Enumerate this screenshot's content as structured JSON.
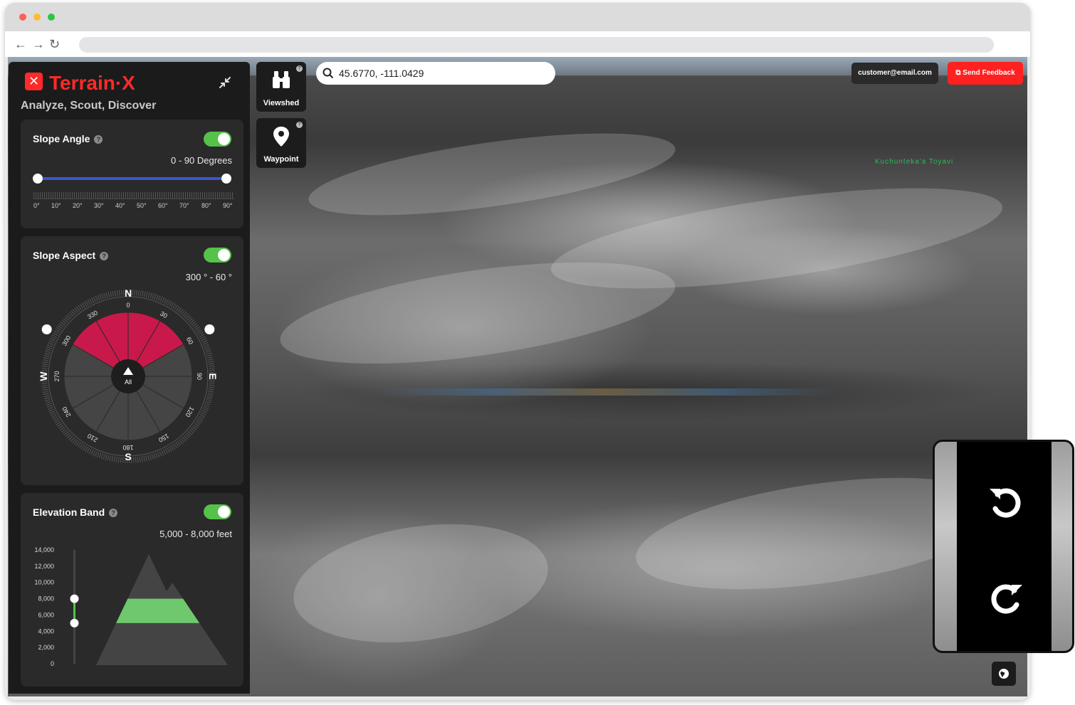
{
  "colors": {
    "brand": "#ff2a2a",
    "toggle_on": "#55c24a",
    "slider": "#3b55d6",
    "aspect_fill": "#c8194a",
    "band_fill": "#6fc86d",
    "panel": "#1b1b1b",
    "card": "#2a2a2a"
  },
  "app": {
    "logo_mark": "✕",
    "name": "Terrain·X",
    "tagline": "Analyze, Scout, Discover"
  },
  "slope_angle": {
    "title": "Slope Angle",
    "enabled": true,
    "range_text": "0 - 90 Degrees",
    "min_value": 0,
    "max_value": 90,
    "tick_labels": [
      "0°",
      "10°",
      "20°",
      "30°",
      "40°",
      "50°",
      "60°",
      "70°",
      "80°",
      "90°"
    ]
  },
  "slope_aspect": {
    "title": "Slope Aspect",
    "enabled": true,
    "range_text": "300 ° - 60 °",
    "start_deg": 300,
    "end_deg": 60,
    "cardinals": {
      "n": "N",
      "e": "E",
      "s": "S",
      "w": "W"
    },
    "degree_labels": [
      "0",
      "30",
      "60",
      "90",
      "120",
      "150",
      "180",
      "210",
      "240",
      "270",
      "300",
      "330"
    ],
    "center_label": "All"
  },
  "elevation_band": {
    "title": "Elevation Band",
    "enabled": true,
    "range_text": "5,000 - 8,000 feet",
    "low_ft": 5000,
    "high_ft": 8000,
    "axis_labels": [
      "14,000",
      "12,000",
      "10,000",
      "8,000",
      "6,000",
      "4,000",
      "2,000",
      "0"
    ]
  },
  "tools": {
    "viewshed": {
      "label": "Viewshed",
      "icon": "binoculars-icon"
    },
    "waypoint": {
      "label": "Waypoint",
      "icon": "map-pin-icon"
    }
  },
  "search": {
    "value": "45.6770, -111.0429",
    "icon": "search-icon"
  },
  "account": {
    "email": "customer@email.com"
  },
  "feedback": {
    "label": "Send Feedback",
    "icon": "external-link-icon"
  },
  "map": {
    "place_label": "Kuchunteka'a Toyavi"
  },
  "controls": {
    "undo_icon": "rotate-ccw-icon",
    "redo_icon": "rotate-cw-icon",
    "globe_icon": "globe-icon"
  }
}
